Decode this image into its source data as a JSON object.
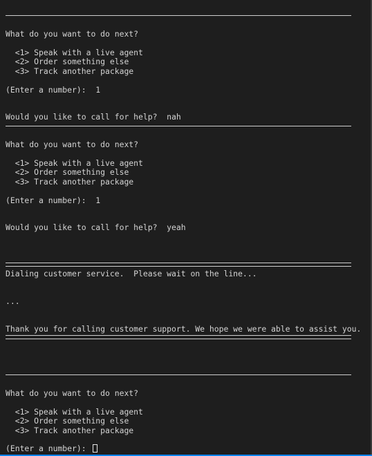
{
  "terminal": {
    "block1": {
      "prompt": "What do you want to do next?",
      "option1": "  <1> Speak with a live agent",
      "option2": "  <2> Order something else",
      "option3": "  <3> Track another package",
      "entry": "(Enter a number):  1",
      "help_question": "Would you like to call for help?  nah"
    },
    "block2": {
      "prompt": "What do you want to do next?",
      "option1": "  <1> Speak with a live agent",
      "option2": "  <2> Order something else",
      "option3": "  <3> Track another package",
      "entry": "(Enter a number):  1",
      "help_question": "Would you like to call for help?  yeah"
    },
    "call": {
      "dialing": "Dialing customer service.  Please wait on the line...",
      "ellipsis": "...",
      "thanks": "Thank you for calling customer support. We hope we were able to assist you."
    },
    "block3": {
      "prompt": "What do you want to do next?",
      "option1": "  <1> Speak with a live agent",
      "option2": "  <2> Order something else",
      "option3": "  <3> Track another package",
      "entry": "(Enter a number):  "
    }
  },
  "colors": {
    "background": "#1e1e1e",
    "text": "#d4d4d4",
    "accent": "#0a84ff"
  }
}
